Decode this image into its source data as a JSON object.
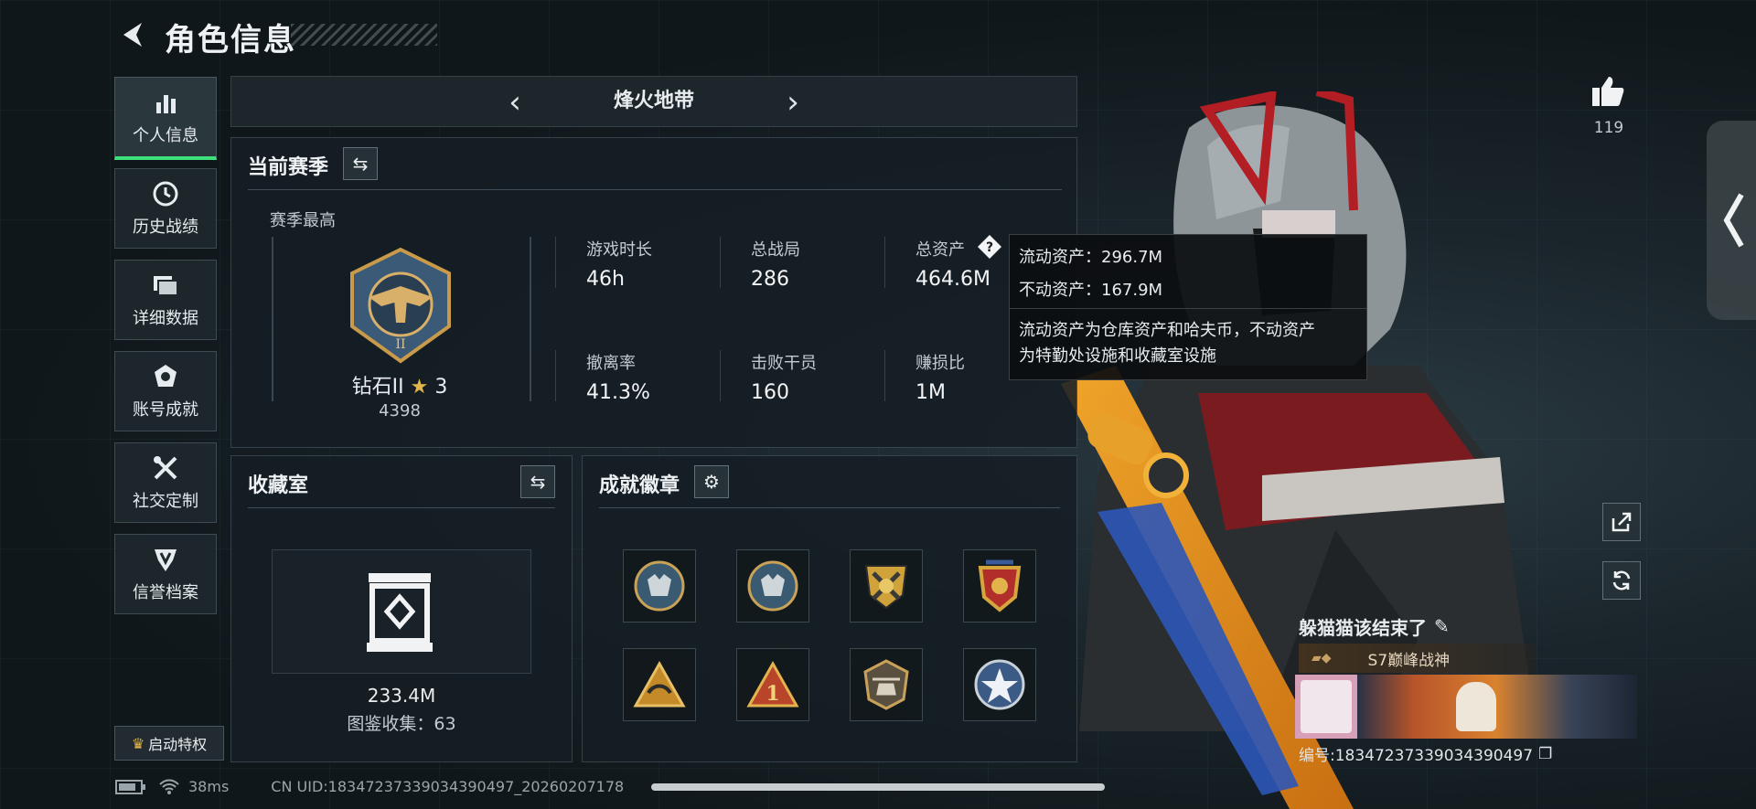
{
  "header": {
    "title": "角色信息",
    "back_icon": "back-arrow-icon"
  },
  "sidebar": {
    "items": [
      {
        "label": "个人信息",
        "icon": "bar-chart-icon",
        "active": true
      },
      {
        "label": "历史战绩",
        "icon": "clock-icon",
        "active": false
      },
      {
        "label": "详细数据",
        "icon": "folder-icon",
        "active": false
      },
      {
        "label": "账号成就",
        "icon": "medal-icon",
        "active": false
      },
      {
        "label": "社交定制",
        "icon": "tools-icon",
        "active": false
      },
      {
        "label": "信誉档案",
        "icon": "shield-icon",
        "active": false
      }
    ],
    "privilege_label": "启动特权"
  },
  "mode_bar": {
    "title": "烽火地带"
  },
  "season": {
    "title": "当前赛季",
    "best_label": "赛季最高",
    "rank_name": "钻石II",
    "rank_stars": "3",
    "rank_score": "4398",
    "stats": [
      {
        "label": "游戏时长",
        "value": "46h"
      },
      {
        "label": "总战局",
        "value": "286"
      },
      {
        "label": "总资产",
        "value": "464.6M"
      },
      {
        "label": "撤离率",
        "value": "41.3%"
      },
      {
        "label": "击败干员",
        "value": "160"
      },
      {
        "label": "赚损比",
        "value": "1M"
      }
    ]
  },
  "tooltip": {
    "liquid": "流动资产：296.7M",
    "fixed": "不动资产：167.9M",
    "desc_line1": "流动资产为仓库资产和哈夫币，不动资产",
    "desc_line2": "为特勤处设施和收藏室设施"
  },
  "collection": {
    "title": "收藏室",
    "value": "233.4M",
    "count_text": "图鉴收集：63"
  },
  "badges": {
    "title": "成就徽章",
    "items": [
      "wolf-badge",
      "wolf-badge-2",
      "shield-crossed-badge",
      "red-shield-badge",
      "triangle-badge",
      "rank-one-badge",
      "helicopter-badge",
      "star-badge"
    ]
  },
  "player": {
    "likes": "119",
    "name": "躲猫猫该结束了",
    "title": "S7巅峰战神",
    "id_text": "编号:18347237339034390497"
  },
  "status": {
    "ping": "38ms",
    "uid": "CN UID:18347237339034390497_20260207178"
  },
  "colors": {
    "accent_green": "#3ee07e",
    "gold": "#d8a63a",
    "background": "#10171b"
  }
}
